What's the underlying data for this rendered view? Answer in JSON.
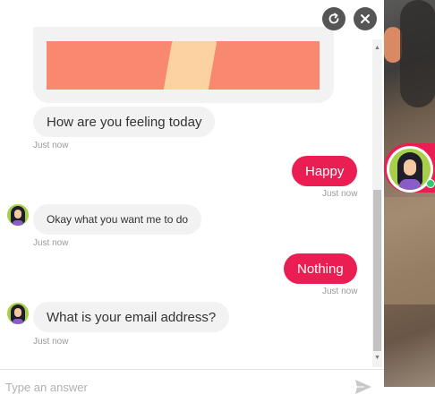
{
  "header": {
    "refresh_icon": "refresh-icon",
    "close_icon": "close-icon"
  },
  "messages": [
    {
      "from": "bot",
      "type": "image",
      "timestamp": ""
    },
    {
      "from": "bot",
      "text": "How are you feeling today",
      "timestamp": "Just now"
    },
    {
      "from": "user",
      "text": "Happy",
      "timestamp": "Just now"
    },
    {
      "from": "bot",
      "text": "Okay what you want me to do",
      "timestamp": "Just now"
    },
    {
      "from": "user",
      "text": "Nothing",
      "timestamp": "Just now"
    },
    {
      "from": "bot",
      "text": "What is your email address?",
      "timestamp": "Just now"
    }
  ],
  "input": {
    "placeholder": "Type an answer",
    "value": ""
  },
  "colors": {
    "accent": "#ea1e52",
    "bot_bubble": "#f2f2f2",
    "online": "#2ecc71"
  }
}
